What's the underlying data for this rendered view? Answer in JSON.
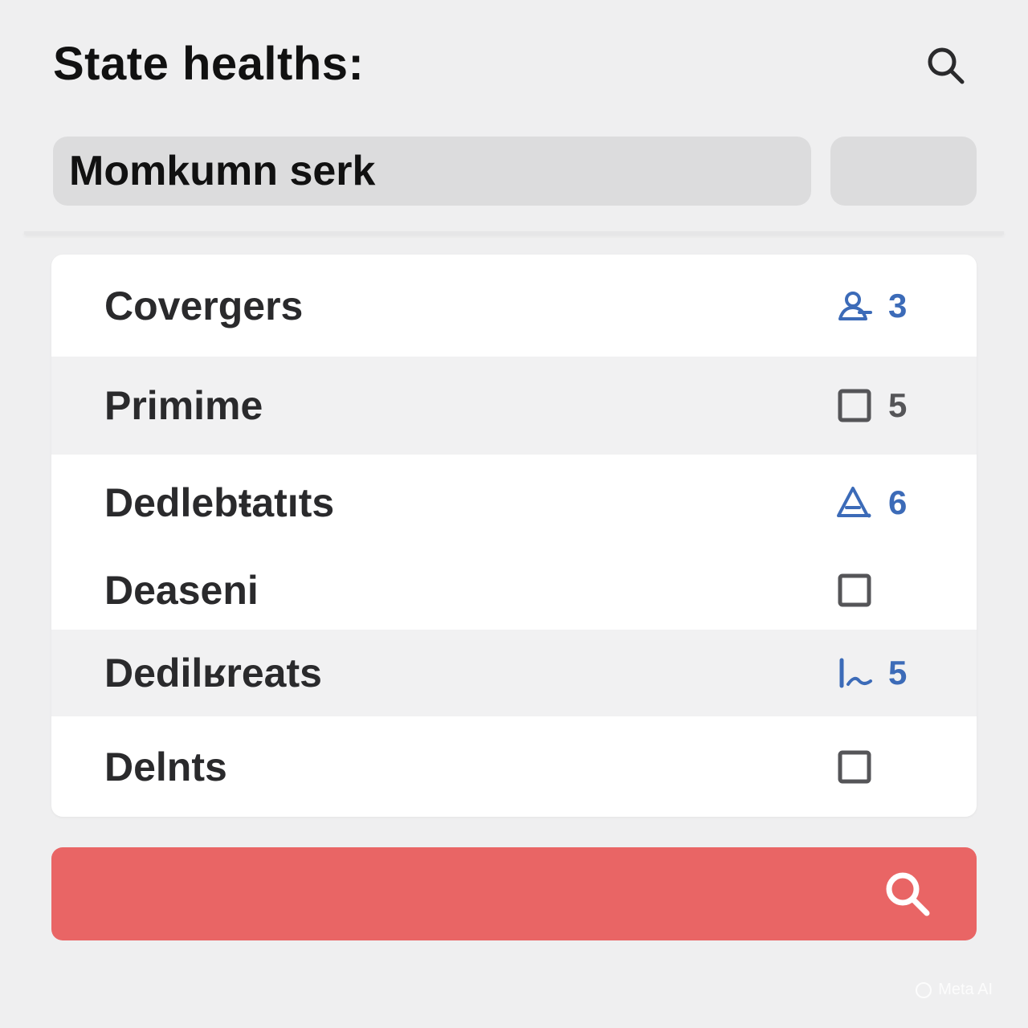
{
  "header": {
    "title": "State healths:",
    "search_icon": "search-icon"
  },
  "search": {
    "value": "Momkumn serk"
  },
  "colors": {
    "background": "#efeff0",
    "accent_blue": "#3c6bb8",
    "action_red": "#e96565",
    "row_shade": "#f1f1f2"
  },
  "list": {
    "items": [
      {
        "label": "Covergers",
        "icon": "person-icon",
        "count": "3",
        "tone": "blue"
      },
      {
        "label": "Primime",
        "icon": "checkbox-icon",
        "count": "5",
        "tone": "gray"
      },
      {
        "label": "Dedlebŧatıts",
        "icon": "warning-icon",
        "count": "6",
        "tone": "blue"
      },
      {
        "label": "Deaseni",
        "icon": "checkbox-icon",
        "count": "",
        "tone": "gray"
      },
      {
        "label": "Dedilʁreats",
        "icon": "trend-icon",
        "count": "5",
        "tone": "blue"
      },
      {
        "label": "Delnts",
        "icon": "checkbox-icon",
        "count": "",
        "tone": "gray"
      }
    ]
  },
  "action_bar": {
    "icon": "search-icon"
  },
  "watermark": {
    "text": "Meta AI"
  }
}
